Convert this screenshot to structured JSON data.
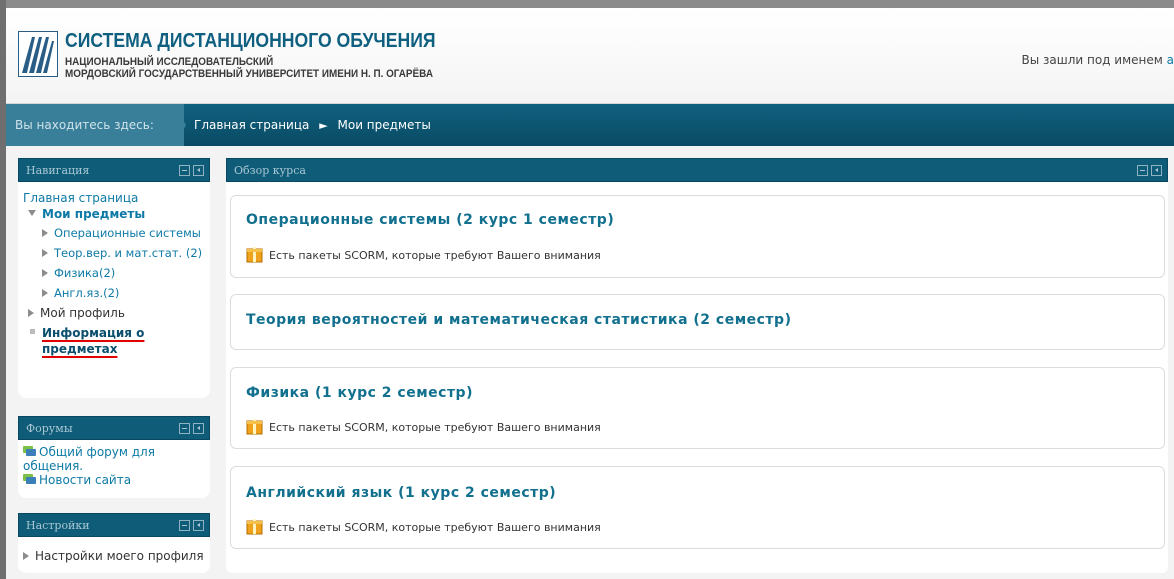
{
  "header": {
    "title": "СИСТЕМА ДИСТАНЦИОННОГО ОБУЧЕНИЯ",
    "subtitle_line1": "НАЦИОНАЛЬНЫЙ ИССЛЕДОВАТЕЛЬСКИЙ",
    "subtitle_line2": "МОРДОВСКИЙ ГОСУДАРСТВЕННЫЙ УНИВЕРСИТЕТ ИМЕНИ Н. П. ОГАРЁВА",
    "login_text": "Вы зашли под именем",
    "login_user": "а"
  },
  "breadcrumb": {
    "label": "Вы находитесь здесь:",
    "home": "Главная страница",
    "separator": "►",
    "current": "Мои предметы"
  },
  "navigation": {
    "title": "Навигация",
    "home": "Главная страница",
    "my_courses": "Мои предметы",
    "courses": [
      "Операционные системы",
      "Теор.вер. и мат.стат. (2)",
      "Физика(2)",
      "Англ.яз.(2)"
    ],
    "profile": "Мой профиль",
    "info": "Информация о предметах"
  },
  "forums": {
    "title": "Форумы",
    "items": [
      "Общий форум для общения.",
      "Новости сайта"
    ]
  },
  "settings": {
    "title": "Настройки",
    "profile_settings": "Настройки моего профиля"
  },
  "main": {
    "title": "Обзор курса",
    "scorm_notice": "Есть пакеты SCORM, которые требуют Вашего внимания",
    "courses": [
      {
        "title": "Операционные системы (2 курс 1 семестр)",
        "has_scorm": true
      },
      {
        "title": "Теория вероятностей и математическая статистика (2 семестр)",
        "has_scorm": false
      },
      {
        "title": "Физика (1 курс 2 семестр)",
        "has_scorm": true
      },
      {
        "title": "Английский язык (1 курс 2 семестр)",
        "has_scorm": true
      }
    ]
  },
  "colors": {
    "brand": "#0f5c79",
    "link": "#0e7aa6",
    "annotation_underline": "#e00000"
  }
}
